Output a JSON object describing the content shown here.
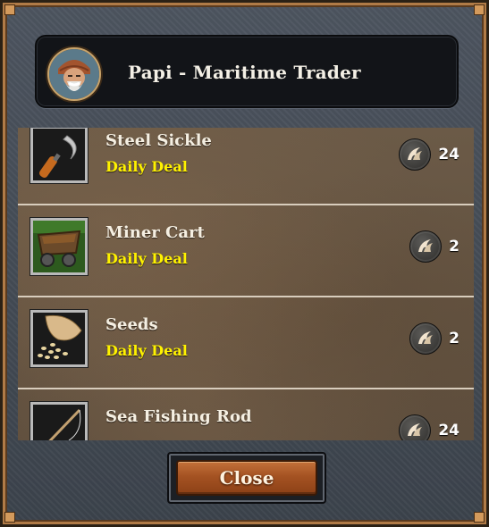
{
  "header": {
    "title": "Papi - Maritime Trader",
    "avatar_icon": "trader-portrait"
  },
  "items": [
    {
      "name": "Steel Sickle",
      "tag": "Daily Deal",
      "price": "24",
      "icon": "sickle-icon",
      "currency_icon": "horn-currency-icon"
    },
    {
      "name": "Miner Cart",
      "tag": "Daily Deal",
      "price": "2",
      "icon": "miner-cart-icon",
      "currency_icon": "horn-currency-icon"
    },
    {
      "name": "Seeds",
      "tag": "Daily Deal",
      "price": "2",
      "icon": "seeds-icon",
      "currency_icon": "horn-currency-icon"
    },
    {
      "name": "Sea Fishing Rod",
      "tag": "",
      "price": "24",
      "icon": "fishing-rod-icon",
      "currency_icon": "horn-currency-icon"
    }
  ],
  "footer": {
    "close_label": "Close"
  },
  "colors": {
    "deal_text": "#fff200",
    "button": "#a45222",
    "frame_trim": "#b07b47"
  }
}
